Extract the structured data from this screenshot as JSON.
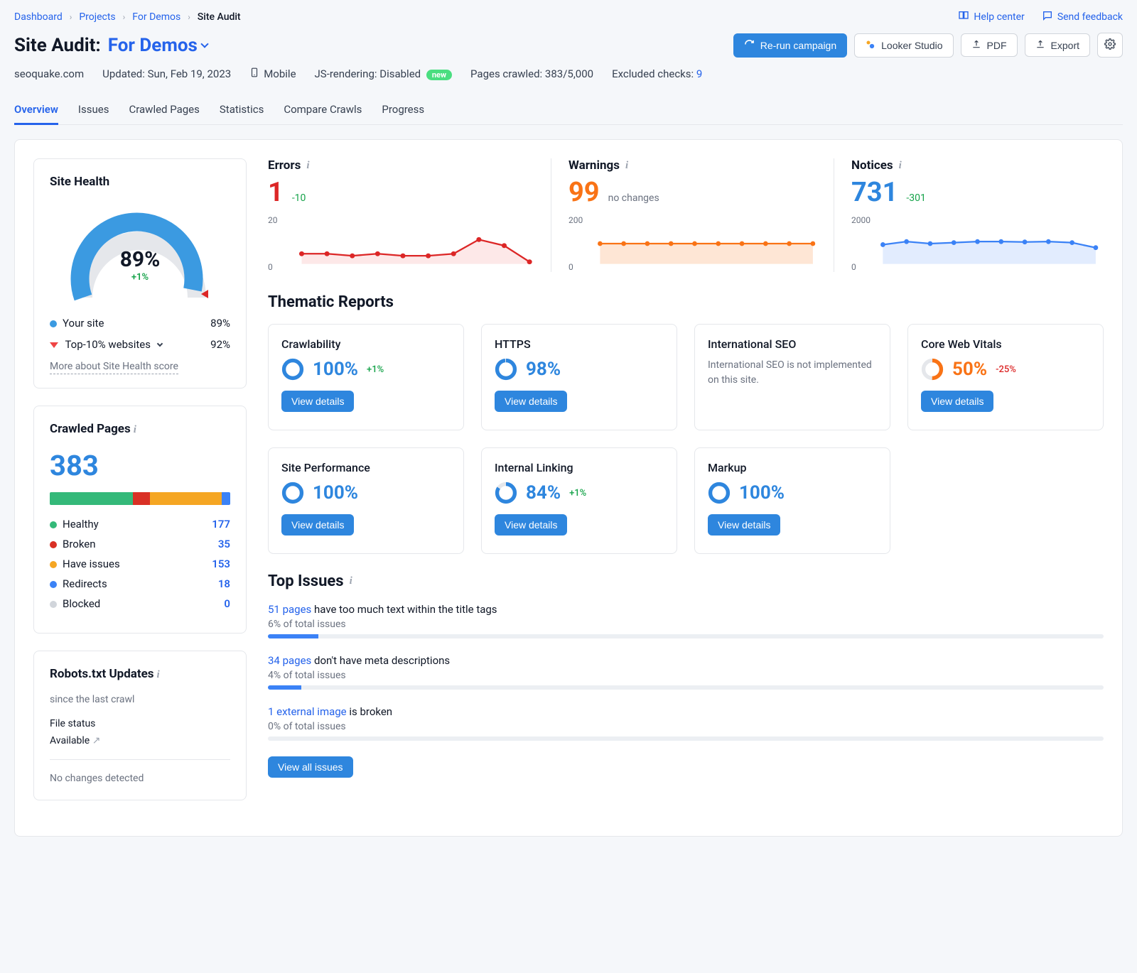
{
  "breadcrumb": [
    "Dashboard",
    "Projects",
    "For Demos",
    "Site Audit"
  ],
  "toplinks": {
    "help": "Help center",
    "feedback": "Send feedback"
  },
  "title": {
    "heading": "Site Audit:",
    "project": "For Demos"
  },
  "actions": {
    "rerun": "Re-run campaign",
    "looker": "Looker Studio",
    "pdf": "PDF",
    "export": "Export"
  },
  "meta": {
    "domain": "seoquake.com",
    "updated": "Updated: Sun, Feb 19, 2023",
    "device": "Mobile",
    "js_label": "JS-rendering: Disabled",
    "js_badge": "new",
    "crawled": "Pages crawled: 383/5,000",
    "excluded_label": "Excluded checks:",
    "excluded_value": "9"
  },
  "tabs": [
    "Overview",
    "Issues",
    "Crawled Pages",
    "Statistics",
    "Compare Crawls",
    "Progress"
  ],
  "site_health": {
    "title": "Site Health",
    "gauge_pct": 89,
    "gauge_delta": "+1%",
    "your_site_label": "Your site",
    "your_site_value": "89%",
    "top10_label": "Top-10% websites",
    "top10_value": "92%",
    "more": "More about Site Health score"
  },
  "crawled_pages": {
    "title": "Crawled Pages",
    "total": "383",
    "segments": [
      {
        "label": "Healthy",
        "value": 177,
        "color": "#34b979"
      },
      {
        "label": "Broken",
        "value": 35,
        "color": "#d93025"
      },
      {
        "label": "Have issues",
        "value": 153,
        "color": "#f5a623"
      },
      {
        "label": "Redirects",
        "value": 18,
        "color": "#3b82f6"
      },
      {
        "label": "Blocked",
        "value": 0,
        "color": "#d1d5db"
      }
    ]
  },
  "robots": {
    "title": "Robots.txt Updates",
    "since": "since the last crawl",
    "file_status_label": "File status",
    "file_status_value": "Available",
    "no_changes": "No changes detected"
  },
  "metrics": {
    "errors": {
      "label": "Errors",
      "value": "1",
      "change": "-10",
      "ymax": "20",
      "y0": "0"
    },
    "warnings": {
      "label": "Warnings",
      "value": "99",
      "change": "no changes",
      "ymax": "200",
      "y0": "0"
    },
    "notices": {
      "label": "Notices",
      "value": "731",
      "change": "-301",
      "ymax": "2000",
      "y0": "0"
    }
  },
  "chart_data": [
    {
      "type": "line",
      "name": "Errors",
      "ylim": [
        0,
        20
      ],
      "x": [
        1,
        2,
        3,
        4,
        5,
        6,
        7,
        8,
        9,
        10
      ],
      "values": [
        5,
        5,
        4,
        5,
        4,
        4,
        5,
        12,
        9,
        1
      ],
      "color": "#dc2626",
      "fill": "rgba(239,68,68,0.12)"
    },
    {
      "type": "area",
      "name": "Warnings",
      "ylim": [
        0,
        200
      ],
      "x": [
        1,
        2,
        3,
        4,
        5,
        6,
        7,
        8,
        9,
        10
      ],
      "values": [
        100,
        100,
        100,
        100,
        100,
        100,
        100,
        100,
        100,
        100
      ],
      "color": "#f97316",
      "fill": "rgba(249,115,22,0.18)"
    },
    {
      "type": "area",
      "name": "Notices",
      "ylim": [
        0,
        2000
      ],
      "x": [
        1,
        2,
        3,
        4,
        5,
        6,
        7,
        8,
        9,
        10
      ],
      "values": [
        950,
        1100,
        1000,
        1050,
        1100,
        1100,
        1080,
        1100,
        1050,
        800
      ],
      "color": "#3b82f6",
      "fill": "rgba(59,130,246,0.15)"
    }
  ],
  "thematic_title": "Thematic Reports",
  "reports": [
    {
      "name": "Crawlability",
      "pct": "100%",
      "delta": "+1%",
      "pct_num": 100,
      "color": "#2e86de"
    },
    {
      "name": "HTTPS",
      "pct": "98%",
      "pct_num": 98,
      "color": "#2e86de"
    },
    {
      "name": "International SEO",
      "note": "International SEO is not implemented on this site."
    },
    {
      "name": "Core Web Vitals",
      "pct": "50%",
      "delta": "-25%",
      "delta_red": true,
      "pct_num": 50,
      "color": "#f97316"
    },
    {
      "name": "Site Performance",
      "pct": "100%",
      "pct_num": 100,
      "color": "#2e86de"
    },
    {
      "name": "Internal Linking",
      "pct": "84%",
      "delta": "+1%",
      "pct_num": 84,
      "color": "#2e86de"
    },
    {
      "name": "Markup",
      "pct": "100%",
      "pct_num": 100,
      "color": "#2e86de"
    }
  ],
  "view_details": "View details",
  "top_issues_title": "Top Issues",
  "issues": [
    {
      "link": "51 pages",
      "rest": " have too much text within the title tags",
      "pct": "6% of total issues",
      "bar": 6
    },
    {
      "link": "34 pages",
      "rest": " don't have meta descriptions",
      "pct": "4% of total issues",
      "bar": 4
    },
    {
      "link": "1 external image",
      "rest": " is broken",
      "pct": "0% of total issues",
      "bar": 0
    }
  ],
  "view_all": "View all issues"
}
